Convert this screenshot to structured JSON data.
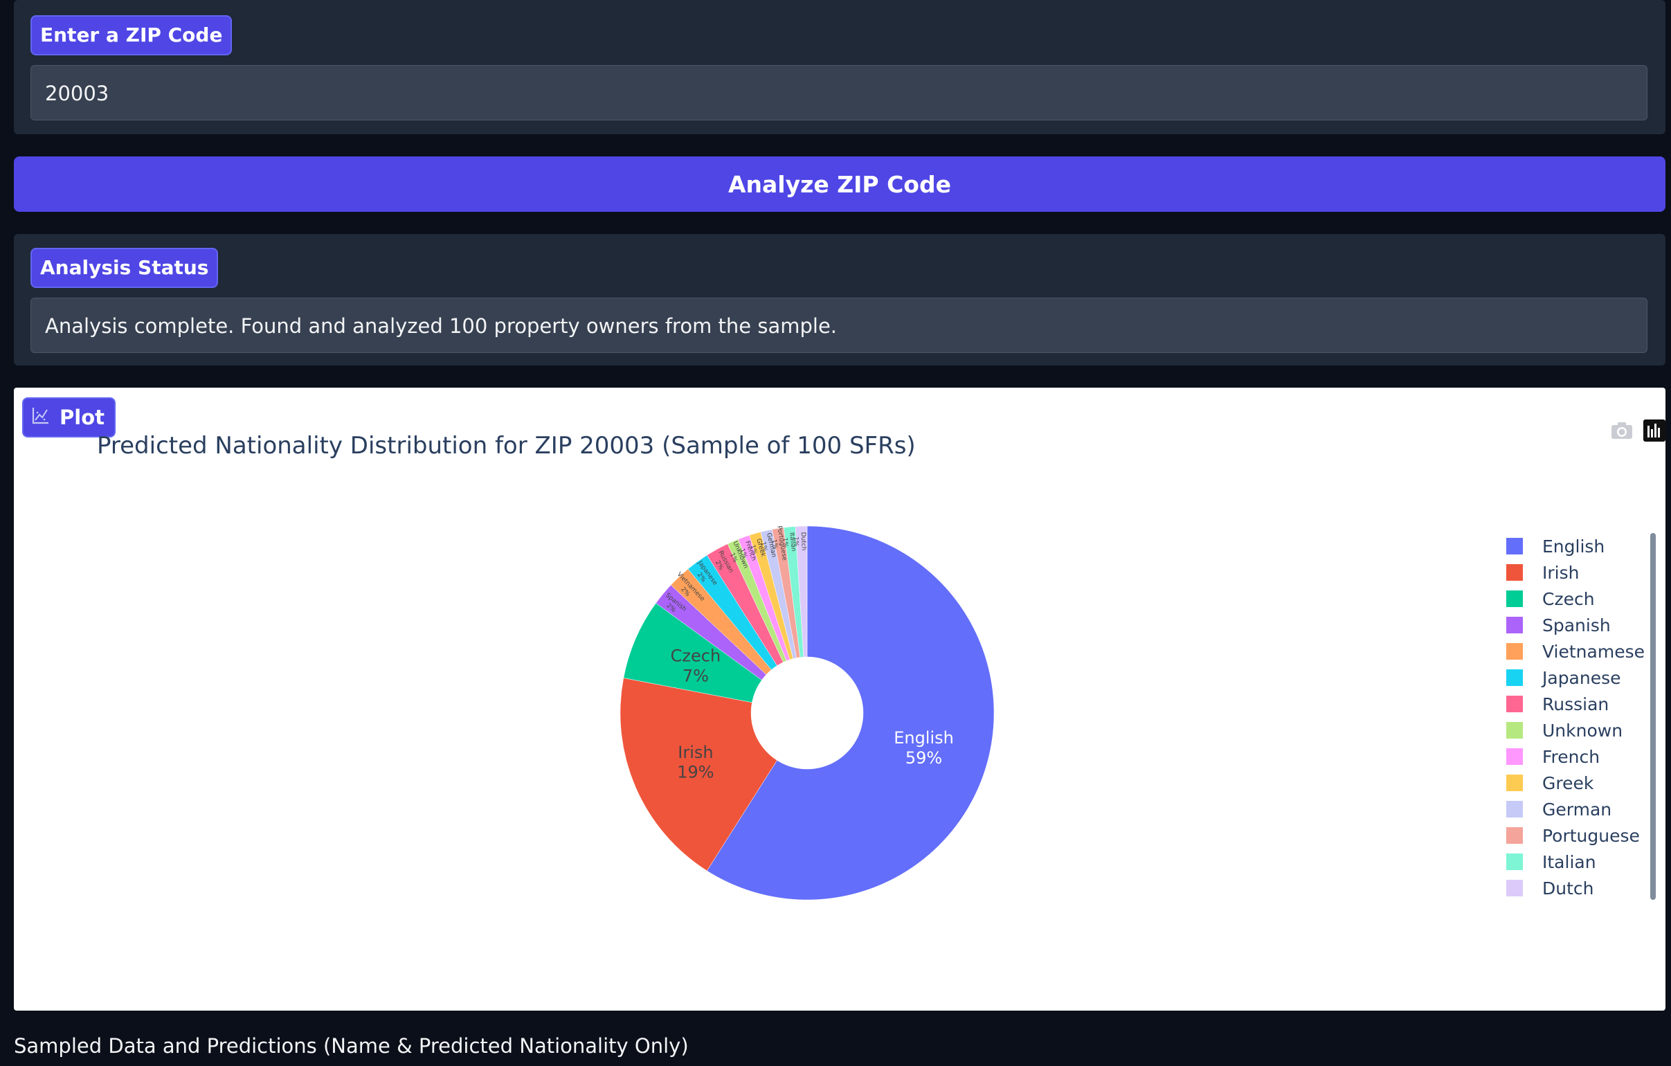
{
  "zip_panel": {
    "label": "Enter a ZIP Code",
    "value": "20003"
  },
  "analyze_button": {
    "label": "Analyze ZIP Code"
  },
  "status_panel": {
    "label": "Analysis Status",
    "text": "Analysis complete. Found and analyzed 100 property owners from the sample."
  },
  "plot_panel": {
    "label": "Plot",
    "icons": [
      "camera-icon",
      "plotly-logo-icon"
    ]
  },
  "chart_data": {
    "type": "pie",
    "hole": 0.3,
    "title": "Predicted Nationality Distribution for ZIP 20003 (Sample of 100 SFRs)",
    "labels": [
      "English",
      "Irish",
      "Czech",
      "Spanish",
      "Vietnamese",
      "Japanese",
      "Russian",
      "Unknown",
      "French",
      "Greek",
      "German",
      "Portuguese",
      "Italian",
      "Dutch"
    ],
    "values": [
      59,
      19,
      7,
      2,
      2,
      2,
      2,
      1,
      1,
      1,
      1,
      1,
      1,
      1
    ],
    "slice_labels": [
      "59%",
      "19%",
      "7%",
      "2%",
      "2%",
      "2%",
      "2%",
      "1%",
      "1%",
      "1%",
      "1%",
      "1%",
      "1%",
      "1%"
    ],
    "colors": [
      "#636efa",
      "#EF553B",
      "#00cc96",
      "#ab63fa",
      "#FFA15A",
      "#19d3f3",
      "#FF6692",
      "#B6E880",
      "#FF97FF",
      "#FECB52",
      "#c6caf7",
      "#f4a49a",
      "#7ef5d4",
      "#dccbfa"
    ],
    "legend_position": "right"
  },
  "footer": {
    "text": "Sampled Data and Predictions (Name & Predicted Nationality Only)"
  }
}
